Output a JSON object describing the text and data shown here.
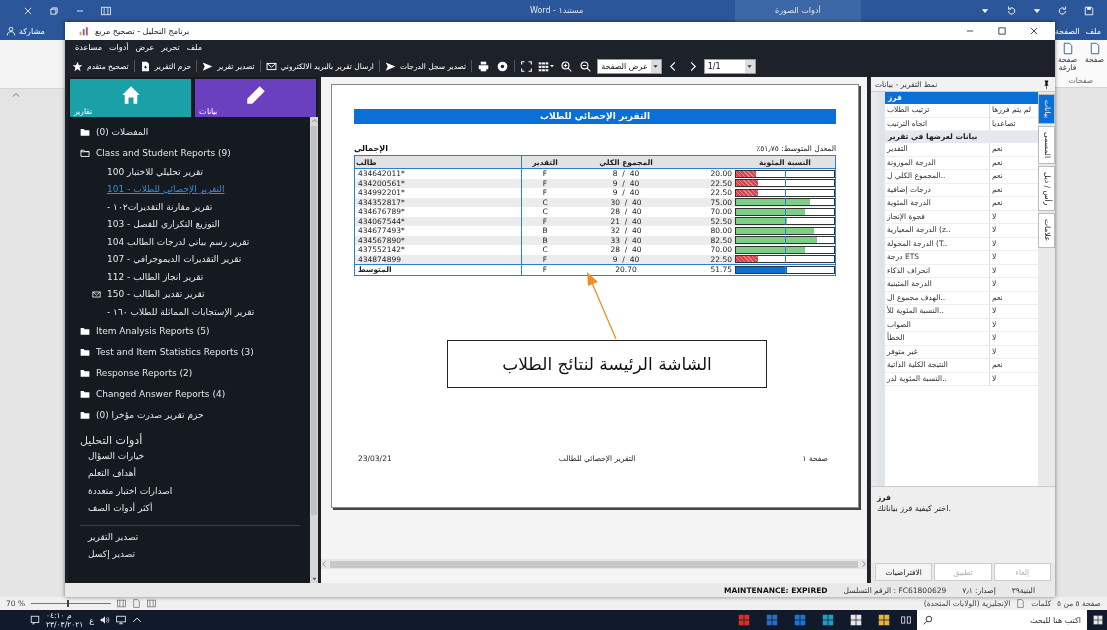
{
  "word": {
    "title": "مستند١ - Word",
    "contextual_tab": "أدوات الصورة",
    "share": "مشاركة",
    "tabs": [
      "ملف",
      "الصفحة"
    ],
    "ribbon_items": [
      "صفحة",
      "صفحة فارغة"
    ],
    "ribbon_group": "صفحات",
    "status": {
      "zoom": "70 %",
      "zoom_slider": {
        "level": 0.45
      },
      "page": "صفحة ٥ من ٥",
      "words": "كلمات",
      "language": "الإنجليزية (الولايات المتحدة)"
    }
  },
  "taskbar": {
    "time": "م ٠٤:١٠",
    "date": "٢٣/٠٣/٢٠٢١",
    "input_language": "ع",
    "search": {
      "placeholder": "اكتب هنا للبحث"
    }
  },
  "app": {
    "title": "برنامج التحليل - تصحيح مربع",
    "menu": [
      "ملف",
      "تحرير",
      "عرض",
      "أدوات",
      "مساعدة"
    ],
    "toolbar": {
      "buttons": [
        "تصدير سجل الدرجات",
        "ارسال تقرير بالبريد الالكتروني",
        "تصدير تقرير",
        "حزم التقرير",
        "تصحيح متقدم"
      ],
      "view_mode": "عرض الصفحة",
      "page": "1/1"
    },
    "tiles": [
      "بيانات",
      "تقارير"
    ],
    "tree": [
      {
        "label": "المفضلات (0)",
        "expanded": false
      },
      {
        "label": "Class and Student Reports (9)",
        "expanded": true,
        "children": [
          {
            "label": "تقرير تحليلي للاختبار 100",
            "kind": "report",
            "selected": false
          },
          {
            "label": "التقرير الإحصائي للطلاب - 101",
            "kind": "report",
            "selected": true
          },
          {
            "label": "- تقرير مقارنة التقديرات١٠٢",
            "kind": "report",
            "selected": false
          },
          {
            "label": "التوزيع التكراري للفصل - 103",
            "kind": "report",
            "selected": false
          },
          {
            "label": "تقرير رسم بياني لدرجات الطالب 104",
            "kind": "report",
            "selected": false
          },
          {
            "label": "تقرير التقديرات الديموجرافي - 107",
            "kind": "report",
            "selected": false
          },
          {
            "label": "تقرير انجاز الطالب - 112",
            "kind": "report",
            "selected": false
          },
          {
            "label": "تقرير تقدير الطالب - 150",
            "kind": "email-report",
            "selected": false
          },
          {
            "label": "- تقرير الإستجابات المماثلة للطلاب ١٦٠",
            "kind": "report",
            "selected": false
          }
        ]
      },
      {
        "label": "Item Analysis Reports (5)",
        "expanded": false
      },
      {
        "label": "Test and Item Statistics Reports (3)",
        "expanded": false
      },
      {
        "label": "Response Reports (2)",
        "expanded": false
      },
      {
        "label": "Changed Answer Reports (4)",
        "expanded": false
      },
      {
        "label": "حزم تقرير صدرت مؤخرا (0)",
        "expanded": false
      }
    ],
    "tools": {
      "heading": "أدوات التحليل",
      "items": [
        "خيارات السؤال",
        "أهداف التعلم",
        "اصدارات اختبار متعددة",
        "أكثر أدوات الصف"
      ]
    },
    "exports": [
      "تصدير التقرير",
      "تصدير إكسل"
    ],
    "status_bar": [
      "البنية٣٩",
      "إصدار: ٧٫١",
      "الرقم التسلسل : FC61800629",
      "MAINTENANCE: EXPIRED"
    ]
  },
  "report": {
    "title": "التقرير الإحصائي للطلاب",
    "section": "الإجمالي",
    "average": "٪المعدل المتوسط: ٥١٫٧٥",
    "columns": [
      "النسبة المئوية",
      "المجموع الكلي",
      "التقدير",
      "طالب"
    ],
    "rows": [
      {
        "kind": "fail",
        "student": "434642011*",
        "grade": "F",
        "total": "8  /  40",
        "percent": "20.00",
        "level": 0.2
      },
      {
        "kind": "fail",
        "student": "434200561*",
        "grade": "F",
        "total": "9  /  40",
        "percent": "22.50",
        "level": 0.225
      },
      {
        "kind": "fail",
        "student": "434992201*",
        "grade": "F",
        "total": "9  /  40",
        "percent": "22.50",
        "level": 0.225
      },
      {
        "kind": "pass",
        "student": "434352817*",
        "grade": "C",
        "total": "30  /  40",
        "percent": "75.00",
        "level": 0.75
      },
      {
        "kind": "pass",
        "student": "434676789*",
        "grade": "C",
        "total": "28  /  40",
        "percent": "70.00",
        "level": 0.7
      },
      {
        "kind": "pass",
        "student": "434067544*",
        "grade": "F",
        "total": "21  /  40",
        "percent": "52.50",
        "level": 0.525
      },
      {
        "kind": "pass",
        "student": "434677493*",
        "grade": "B",
        "total": "32  /  40",
        "percent": "80.00",
        "level": 0.8
      },
      {
        "kind": "pass",
        "student": "434567890*",
        "grade": "B",
        "total": "33  /  40",
        "percent": "82.50",
        "level": 0.825
      },
      {
        "kind": "pass",
        "student": "437552142*",
        "grade": "C",
        "total": "28  /  40",
        "percent": "70.00",
        "level": 0.7
      },
      {
        "kind": "fail",
        "student": "434874899",
        "grade": "F",
        "total": "9  /  40",
        "percent": "22.50",
        "level": 0.225
      },
      {
        "kind": "average",
        "student": "المتوسط",
        "grade": "F",
        "total": "20.70",
        "percent": "51.75",
        "level": 0.5175
      }
    ],
    "footer": {
      "date": "23/03/21",
      "name": "التقرير الإحصائي للطالب",
      "page": "صفحة ١"
    },
    "callout": "الشاشة الرئيسة لنتائج الطلاب"
  },
  "properties": {
    "title": "نمط التقرير - بيانات",
    "tabs": [
      {
        "label": "بيانات",
        "selected": true
      },
      {
        "label": "المسمى",
        "selected": false
      },
      {
        "label": "رأس / ذيل",
        "selected": false
      },
      {
        "label": "علامات",
        "selected": false
      }
    ],
    "groups": [
      {
        "header": "فرز",
        "selected": true,
        "rows": [
          {
            "property": "ترتيب الطلاب",
            "value": "لم يتم فرزها"
          },
          {
            "property": "اتجاه الترتيب",
            "value": "تصاعديا"
          }
        ]
      },
      {
        "header": "بيانات لعرضها في تقرير",
        "selected": false,
        "rows": [
          {
            "property": "التقدير",
            "value": "نعم"
          },
          {
            "property": "الدرجة الموزونة",
            "value": "نعم"
          },
          {
            "property": "المجموع الكلي ل..",
            "value": "نعم"
          },
          {
            "property": "درجات إضافية",
            "value": "نعم"
          },
          {
            "property": "الدرجة المئوية",
            "value": "نعم"
          },
          {
            "property": "فجوة الإنجاز",
            "value": "لا"
          },
          {
            "property": "الدرجة المعيارية (z..",
            "value": "لا"
          },
          {
            "property": "الدرجة المحولة (T..",
            "value": "لا"
          },
          {
            "property": "درجة ETS",
            "value": "لا"
          },
          {
            "property": "انحراف الذكاء",
            "value": "لا"
          },
          {
            "property": "الدرجة المئينية",
            "value": "لا"
          },
          {
            "property": "الهدف مجموع ال..",
            "value": "نعم"
          },
          {
            "property": "النسبة المئوية للأ..",
            "value": "لا"
          },
          {
            "property": "الصواب",
            "value": "لا"
          },
          {
            "property": "الخطأ",
            "value": "لا"
          },
          {
            "property": "غير متوفر",
            "value": "لا"
          },
          {
            "property": "النتيجة الكلية الذاتية",
            "value": "نعم"
          },
          {
            "property": "النسبة المئوية لدر..",
            "value": "لا"
          }
        ]
      }
    ],
    "description": {
      "title": "فرز",
      "text": "اختر كيفية فرز بياناتك."
    },
    "buttons": [
      {
        "label": "إلغاء",
        "disabled": true
      },
      {
        "label": "تطبيق",
        "disabled": true
      },
      {
        "label": "الافتراضيات",
        "disabled": false
      }
    ]
  }
}
